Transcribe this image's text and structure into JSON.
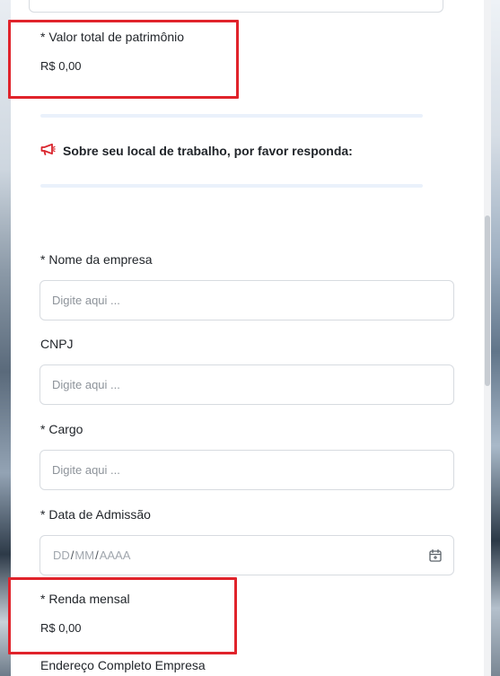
{
  "form": {
    "patrimonio": {
      "label": "* Valor total de patrimônio",
      "value": "R$ 0,00"
    },
    "section": {
      "title": "Sobre seu local de trabalho, por favor responda:",
      "icon": "megaphone-icon"
    },
    "empresa": {
      "label": "* Nome da empresa",
      "placeholder": "Digite aqui ..."
    },
    "cnpj": {
      "label": "CNPJ",
      "placeholder": "Digite aqui ..."
    },
    "cargo": {
      "label": "* Cargo",
      "placeholder": "Digite aqui ..."
    },
    "admissao": {
      "label": "* Data de Admissão",
      "day": "DD",
      "month": "MM",
      "year": "AAAA",
      "separator": "/",
      "icon": "calendar-icon"
    },
    "renda": {
      "label": "* Renda mensal",
      "value": "R$ 0,00"
    },
    "endereco": {
      "label": "Endereço Completo Empresa"
    }
  },
  "colors": {
    "highlight": "#e0232b",
    "divider": "#eaf1fb",
    "icon_red": "#d9252d"
  }
}
